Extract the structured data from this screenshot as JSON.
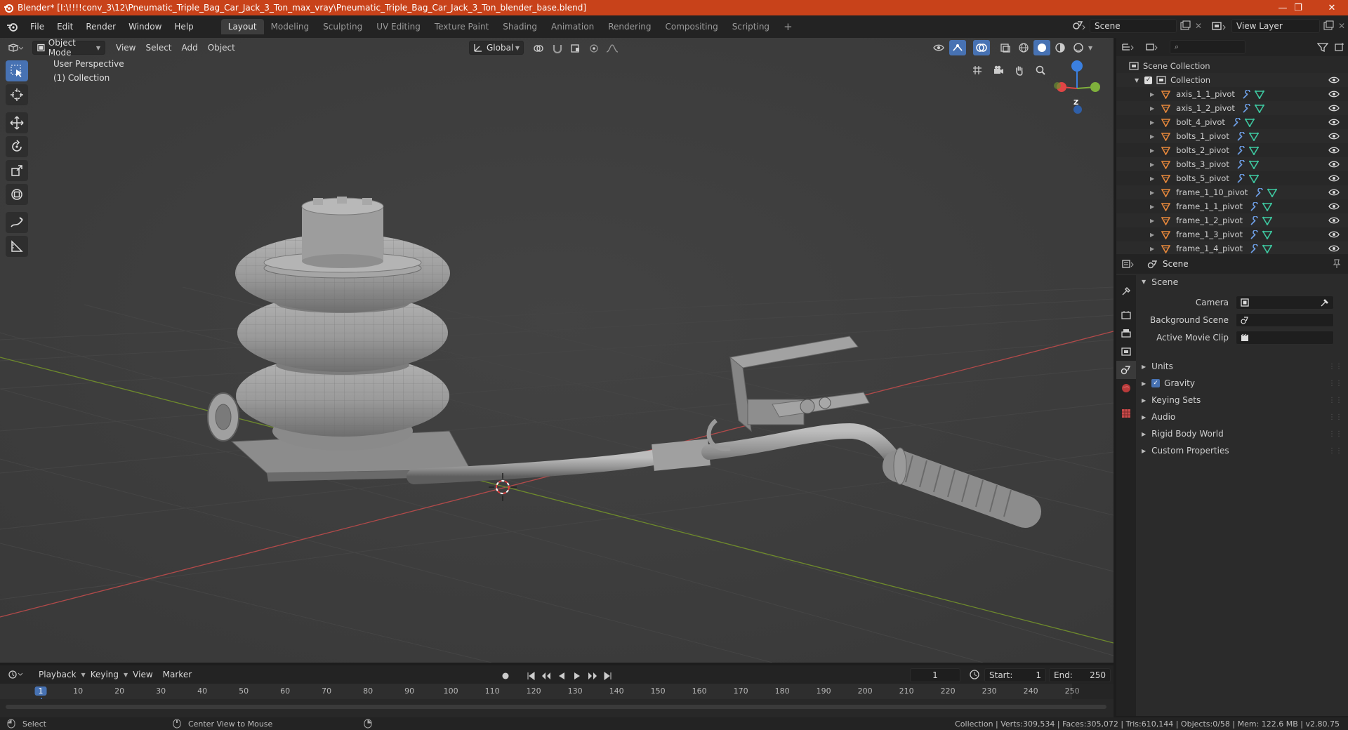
{
  "window": {
    "title": "Blender* [I:\\!!!!conv_3\\12\\Pneumatic_Triple_Bag_Car_Jack_3_Ton_max_vray\\Pneumatic_Triple_Bag_Car_Jack_3_Ton_blender_base.blend]",
    "minimize": "—",
    "maximize": "❐",
    "close": "✕"
  },
  "menu": [
    "File",
    "Edit",
    "Render",
    "Window",
    "Help"
  ],
  "workspaces": [
    "Layout",
    "Modeling",
    "Sculpting",
    "UV Editing",
    "Texture Paint",
    "Shading",
    "Animation",
    "Rendering",
    "Compositing",
    "Scripting"
  ],
  "add_workspace": "+",
  "scene_field": "Scene",
  "view_layer_field": "View Layer",
  "viewport_header": {
    "mode": "Object Mode",
    "menus": [
      "View",
      "Select",
      "Add",
      "Object"
    ],
    "transform_orientation": "Global"
  },
  "viewport": {
    "perspective_label": "User Perspective",
    "collection_label": "(1) Collection",
    "gizmo_z": "Z"
  },
  "outliner": {
    "search_placeholder": "",
    "root": "Scene Collection",
    "collection": "Collection",
    "items": [
      "axis_1_1_pivot",
      "axis_1_2_pivot",
      "bolt_4_pivot",
      "bolts_1_pivot",
      "bolts_2_pivot",
      "bolts_3_pivot",
      "bolts_5_pivot",
      "frame_1_10_pivot",
      "frame_1_1_pivot",
      "frame_1_2_pivot",
      "frame_1_3_pivot",
      "frame_1_4_pivot"
    ]
  },
  "properties": {
    "header_title": "Scene",
    "panel_title": "Scene",
    "camera_label": "Camera",
    "background_scene_label": "Background Scene",
    "active_movie_clip_label": "Active Movie Clip",
    "sections": [
      "Units",
      "Gravity",
      "Keying Sets",
      "Audio",
      "Rigid Body World",
      "Custom Properties"
    ],
    "gravity_checked": true
  },
  "timeline": {
    "menus": [
      "Playback",
      "Keying",
      "View",
      "Marker"
    ],
    "current_frame": "1",
    "start_label": "Start:",
    "start_value": "1",
    "end_label": "End:",
    "end_value": "250",
    "ruler": [
      "1",
      "10",
      "20",
      "30",
      "40",
      "50",
      "60",
      "70",
      "80",
      "90",
      "100",
      "110",
      "120",
      "130",
      "140",
      "150",
      "160",
      "170",
      "180",
      "190",
      "200",
      "210",
      "220",
      "230",
      "240",
      "250"
    ]
  },
  "statusbar": {
    "select": "Select",
    "center_view": "Center View to Mouse",
    "stats": "Collection | Verts:309,534 | Faces:305,072 | Tris:610,144 | Objects:0/58 | Mem: 122.6 MB | v2.80.75"
  },
  "colors": {
    "titlebar": "#c8421a",
    "accent_blue": "#4772b3",
    "axis_x": "#e04545",
    "axis_y": "#7fb03c",
    "axis_z": "#3b80e0",
    "object_orange": "#e5873b",
    "mesh_green": "#3ec7a0"
  }
}
